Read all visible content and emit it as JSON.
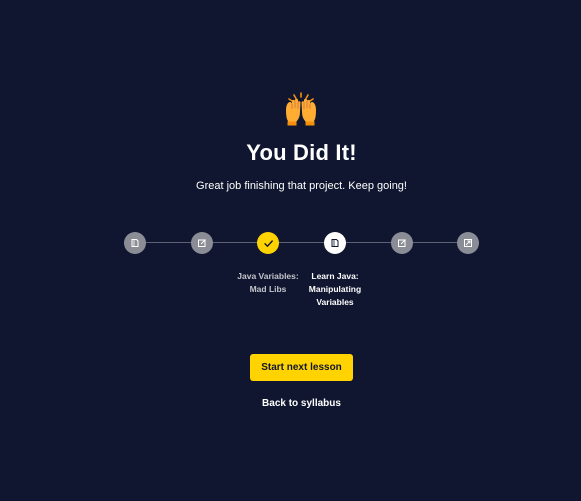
{
  "celebration": {
    "icon": "raising-hands-icon",
    "title": "You Did It!",
    "subtitle": "Great job finishing that project. Keep going!"
  },
  "progress": {
    "steps": [
      {
        "state": "upcoming",
        "icon": "lesson-icon"
      },
      {
        "state": "upcoming",
        "icon": "quiz-icon"
      },
      {
        "state": "completed",
        "icon": "check-icon",
        "label_line1": "Java Variables:",
        "label_line2": "Mad Libs"
      },
      {
        "state": "current",
        "icon": "lesson-icon",
        "label_line1": "Learn Java:",
        "label_line2": "Manipulating",
        "label_line3": "Variables"
      },
      {
        "state": "upcoming",
        "icon": "quiz-icon"
      },
      {
        "state": "upcoming",
        "icon": "project-icon"
      }
    ]
  },
  "actions": {
    "next_lesson_label": "Start next lesson",
    "back_label": "Back to syllabus"
  },
  "colors": {
    "background": "#10162f",
    "accent": "#ffd300",
    "upcoming": "#8b8d96",
    "track": "#5e6275"
  }
}
